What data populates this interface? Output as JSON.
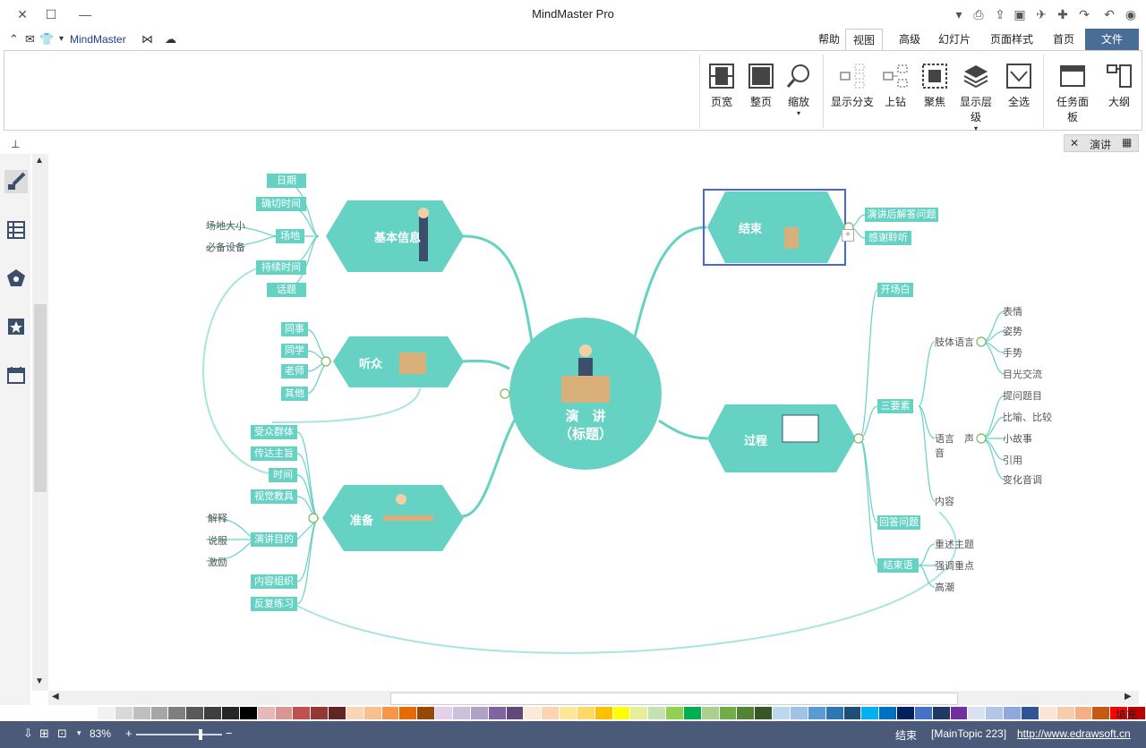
{
  "titlebar": {
    "title": "MindMaster Pro"
  },
  "menu": {
    "app_name": "MindMaster",
    "tabs": [
      "文件",
      "首页",
      "页面样式",
      "幻灯片",
      "高级",
      "视图",
      "帮助"
    ]
  },
  "ribbon": {
    "left_buttons": [
      "大纲",
      "任务面板",
      "全选",
      "显示层级",
      "聚焦",
      "上钻",
      "显示分支"
    ],
    "right_buttons": [
      "缩放",
      "整页",
      "页宽"
    ]
  },
  "panel": {
    "tab_label": "演讲"
  },
  "mindmap": {
    "center": {
      "line1": "演　讲",
      "line2": "（标题）"
    },
    "topics": {
      "basic": "基本信息",
      "audience": "听众",
      "prepare": "准备",
      "end": "结束",
      "process": "过程"
    },
    "basic_items": [
      "日期",
      "确切时间",
      "场地",
      "持续时间",
      "话题"
    ],
    "venue_items": [
      "场地大小",
      "必备设备"
    ],
    "audience_items": [
      "同事",
      "同学",
      "老师",
      "其他"
    ],
    "prepare_items": [
      "受众群体",
      "传达主旨",
      "时间",
      "视觉教具",
      "演讲目的",
      "内容组织",
      "反复练习"
    ],
    "purpose_items": [
      "解释",
      "说服",
      "激励"
    ],
    "end_items": [
      "演讲后解答问题",
      "感谢聆听"
    ],
    "process_items": [
      "开场白",
      "三要素",
      "回答问题",
      "结束语"
    ],
    "three_elements": [
      "肢体语言",
      "语言　声音",
      "内容"
    ],
    "body_items": [
      "表情",
      "姿势",
      "手势",
      "目光交流"
    ],
    "voice_items": [
      "提问题目",
      "比喻、比较",
      "小故事",
      "引用",
      "变化音调"
    ],
    "closing_items": [
      "重述主题",
      "强调重点",
      "高潮"
    ]
  },
  "status": {
    "url": "http://www.edrawsoft.cn",
    "topic": "[MainTopic 223]",
    "state": "结束",
    "zoom": "83%",
    "fill_label": "填充"
  },
  "colors": {
    "accent": "#66d2c3",
    "line": "#66d2c3",
    "status_bg": "#4a5a78"
  }
}
